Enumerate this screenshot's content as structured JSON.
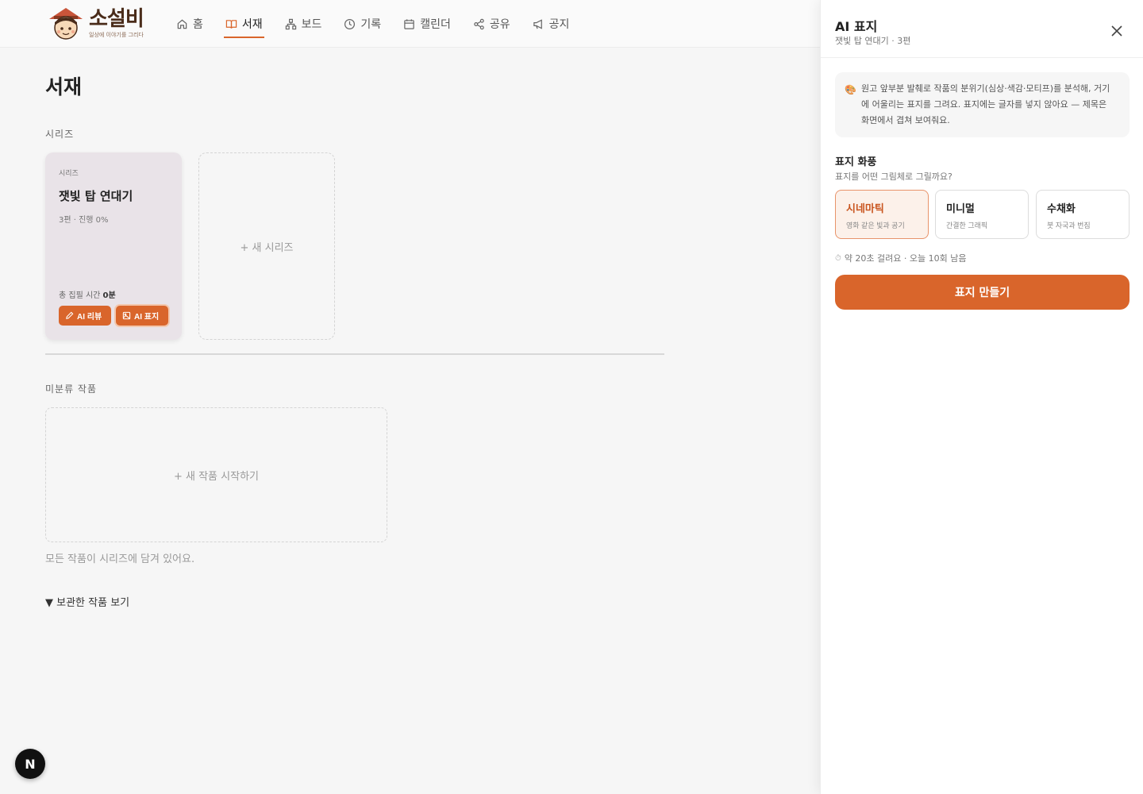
{
  "header": {
    "logo_title": "소설비",
    "logo_subtitle": "일상에 이야기를 그리다",
    "nav": [
      {
        "label": "홈",
        "icon": "home-icon"
      },
      {
        "label": "서재",
        "icon": "book-open-icon",
        "active": true
      },
      {
        "label": "보드",
        "icon": "diagram-icon"
      },
      {
        "label": "기록",
        "icon": "clock-icon"
      },
      {
        "label": "캘린더",
        "icon": "calendar-icon"
      },
      {
        "label": "공유",
        "icon": "share-icon"
      },
      {
        "label": "공지",
        "icon": "megaphone-icon"
      }
    ]
  },
  "main": {
    "title": "서재",
    "series_label": "시리즈",
    "series_card": {
      "tag": "시리즈",
      "title": "잿빛 탑 연대기",
      "meta": "3편 · 진행 0%",
      "time_label": "총 집필 시간",
      "time_value": "0분",
      "review_button": "AI 리뷰",
      "cover_button": "AI 표지"
    },
    "new_series": "+ 새 시리즈",
    "uncategorized_label": "미분류 작품",
    "new_work": "+ 새 작품 시작하기",
    "empty_note": "모든 작품이 시리즈에 담겨 있어요.",
    "archive_toggle": "▼ 보관한 작품 보기"
  },
  "badge": {
    "label": "N"
  },
  "panel": {
    "title": "AI 표지",
    "subtitle": "잿빛 탑 연대기 · 3편",
    "info_icon": "palette-icon",
    "info_text": "원고 앞부분 발췌로 작품의 분위기(심상·색감·모티프)를 분석해, 거기에 어울리는 표지를 그려요. 표지에는 글자를 넣지 않아요 — 제목은 화면에서 겹쳐 보여줘요.",
    "style_label": "표지 화풍",
    "style_hint": "표지를 어떤 그림체로 그릴까요?",
    "options": [
      {
        "name": "시네마틱",
        "desc": "영화 같은 빛과 공기",
        "selected": true
      },
      {
        "name": "미니멀",
        "desc": "간결한 그래픽"
      },
      {
        "name": "수채화",
        "desc": "붓 자국과 번짐"
      }
    ],
    "eta": "약 20초 걸려요 · 오늘 10회 남음",
    "generate_button": "표지 만들기"
  },
  "colors": {
    "accent": "#d9652b",
    "card_bg": "#e9e3e8",
    "selected_bg": "#fcf1ea"
  }
}
